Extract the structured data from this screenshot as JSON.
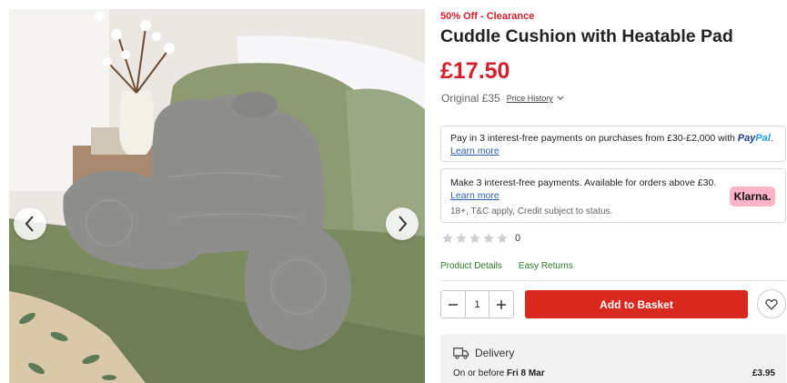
{
  "product": {
    "sale_tag": "50% Off - Clearance",
    "title": "Cuddle Cushion with Heatable Pad",
    "price": "£17.50",
    "original_price": "Original £35",
    "price_history_label": "Price History"
  },
  "payments": {
    "paypal": {
      "text": "Pay in 3 interest-free payments on purchases from £30-£2,000 with",
      "logo_part1": "Pay",
      "logo_part2": "Pal",
      "learn_more": "Learn more"
    },
    "klarna": {
      "text": "Make 3 interest-free payments. Available for orders above £30.",
      "learn_more": "Learn more",
      "note": "18+, T&C apply, Credit subject to status.",
      "logo": "Klarna."
    }
  },
  "rating": {
    "stars_filled": 0,
    "stars_total": 5,
    "count": "0"
  },
  "links": {
    "product_details": "Product Details",
    "easy_returns": "Easy Returns"
  },
  "basket": {
    "quantity": "1",
    "add_label": "Add to Basket"
  },
  "delivery": {
    "title": "Delivery",
    "date_prefix": "On or before",
    "date": "Fri 8 Mar",
    "price": "£3.95"
  },
  "colors": {
    "sale_red": "#d3202a",
    "button_red": "#d9281e",
    "link_blue": "#2a5da8",
    "link_green": "#2a7a2a",
    "klarna_pink": "#ffb3c7"
  }
}
